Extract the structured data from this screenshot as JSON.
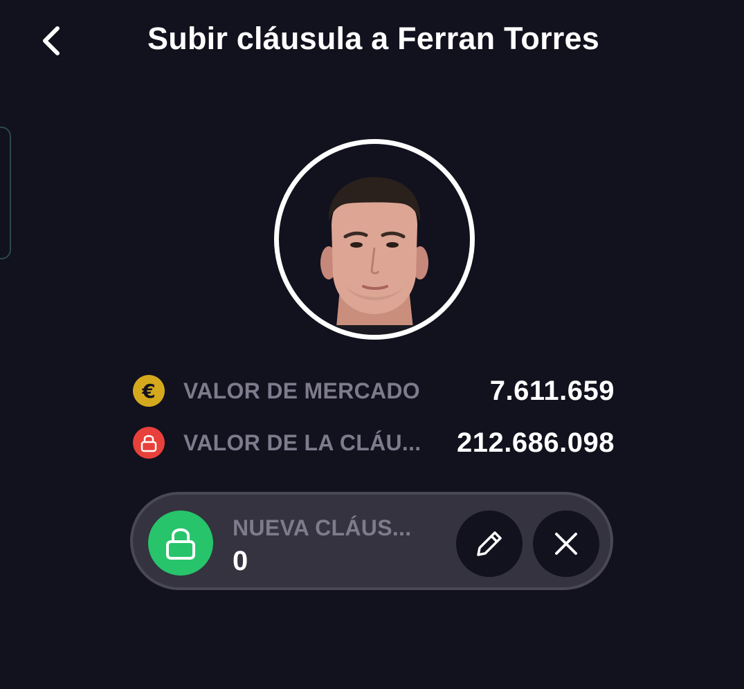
{
  "header": {
    "title": "Subir cláusula a Ferran Torres",
    "back_icon": "chevron-left-icon"
  },
  "player": {
    "photo_icon": "player-portrait-icon"
  },
  "stats": {
    "market_value": {
      "icon": "euro-icon",
      "icon_color": "#d4a91d",
      "label": "VALOR DE MERCADO",
      "value": "7.611.659"
    },
    "clause_value": {
      "icon": "lock-icon",
      "icon_color": "#e8403a",
      "label": "VALOR DE LA CLÁU...",
      "value": "212.686.098"
    }
  },
  "new_clause": {
    "icon": "lock-open-icon",
    "icon_color": "#27c46b",
    "label": "NUEVA CLÁUS...",
    "value": "0",
    "edit_icon": "pencil-icon",
    "close_icon": "close-icon"
  },
  "colors": {
    "background": "#12111e",
    "pill": "#34333f",
    "muted_text": "#7d7b8c"
  }
}
